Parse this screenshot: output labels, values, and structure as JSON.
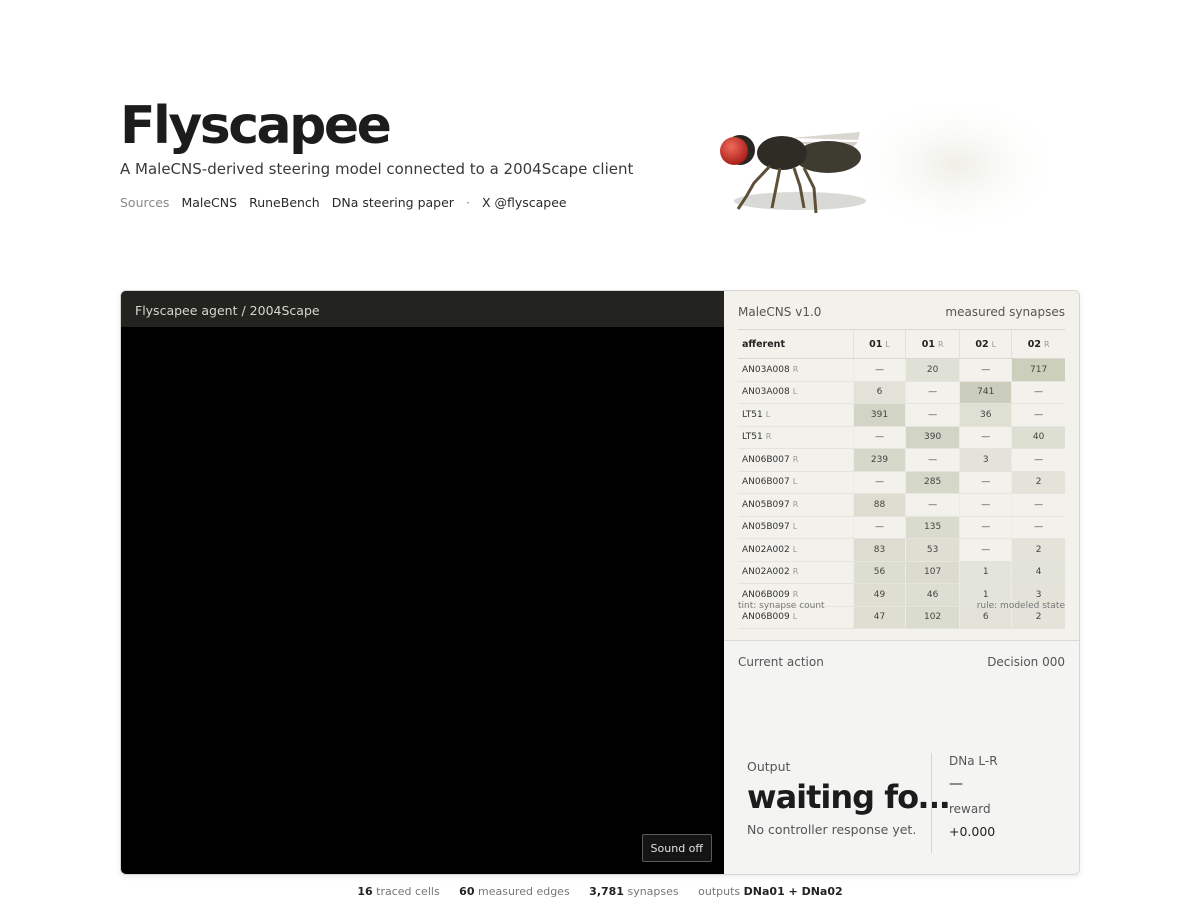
{
  "header": {
    "title": "Flyscapee",
    "subtitle": "A MaleCNS-derived steering model connected to a 2004Scape client",
    "sources_label": "Sources",
    "links": [
      "MaleCNS",
      "RuneBench",
      "DNa steering paper"
    ],
    "separator": "·",
    "social": "X @flyscapee"
  },
  "game": {
    "title": "Flyscapee agent / 2004Scape",
    "sound_button": "Sound off"
  },
  "synapses": {
    "title": "MaleCNS v1.0",
    "subtitle": "measured synapses",
    "afferent_header": "afferent",
    "columns": [
      {
        "label": "01",
        "side": "L"
      },
      {
        "label": "01",
        "side": "R"
      },
      {
        "label": "02",
        "side": "L"
      },
      {
        "label": "02",
        "side": "R"
      }
    ],
    "rows": [
      {
        "name": "AN03A008",
        "side": "R",
        "values": [
          "—",
          "20",
          "—",
          "717"
        ]
      },
      {
        "name": "AN03A008",
        "side": "L",
        "values": [
          "6",
          "—",
          "741",
          "—"
        ]
      },
      {
        "name": "LT51",
        "side": "L",
        "values": [
          "391",
          "—",
          "36",
          "—"
        ]
      },
      {
        "name": "LT51",
        "side": "R",
        "values": [
          "—",
          "390",
          "—",
          "40"
        ]
      },
      {
        "name": "AN06B007",
        "side": "R",
        "values": [
          "239",
          "—",
          "3",
          "—"
        ]
      },
      {
        "name": "AN06B007",
        "side": "L",
        "values": [
          "—",
          "285",
          "—",
          "2"
        ]
      },
      {
        "name": "AN05B097",
        "side": "R",
        "values": [
          "88",
          "—",
          "—",
          "—"
        ]
      },
      {
        "name": "AN05B097",
        "side": "L",
        "values": [
          "—",
          "135",
          "—",
          "—"
        ]
      },
      {
        "name": "AN02A002",
        "side": "L",
        "values": [
          "83",
          "53",
          "—",
          "2"
        ]
      },
      {
        "name": "AN02A002",
        "side": "R",
        "values": [
          "56",
          "107",
          "1",
          "4"
        ]
      },
      {
        "name": "AN06B009",
        "side": "R",
        "values": [
          "49",
          "46",
          "1",
          "3"
        ]
      },
      {
        "name": "AN06B009",
        "side": "L",
        "values": [
          "47",
          "102",
          "6",
          "2"
        ]
      }
    ],
    "foot_left": "tint: synapse count",
    "foot_right": "rule: modeled state",
    "tint_color": "#c9cbbb"
  },
  "action": {
    "title": "Current action",
    "decision": "Decision 000",
    "output_label": "Output",
    "output_value": "waiting fo…",
    "output_note": "No controller response yet.",
    "dna_label": "DNa L-R",
    "dna_value": "—",
    "reward_label": "reward",
    "reward_value": "+0.000"
  },
  "footer": {
    "traced_count": "16",
    "traced_label": "traced cells",
    "edges_count": "60",
    "edges_label": "measured edges",
    "synapses_count": "3,781",
    "synapses_label": "synapses",
    "outputs_label": "outputs",
    "outputs_value": "DNa01 + DNa02"
  }
}
